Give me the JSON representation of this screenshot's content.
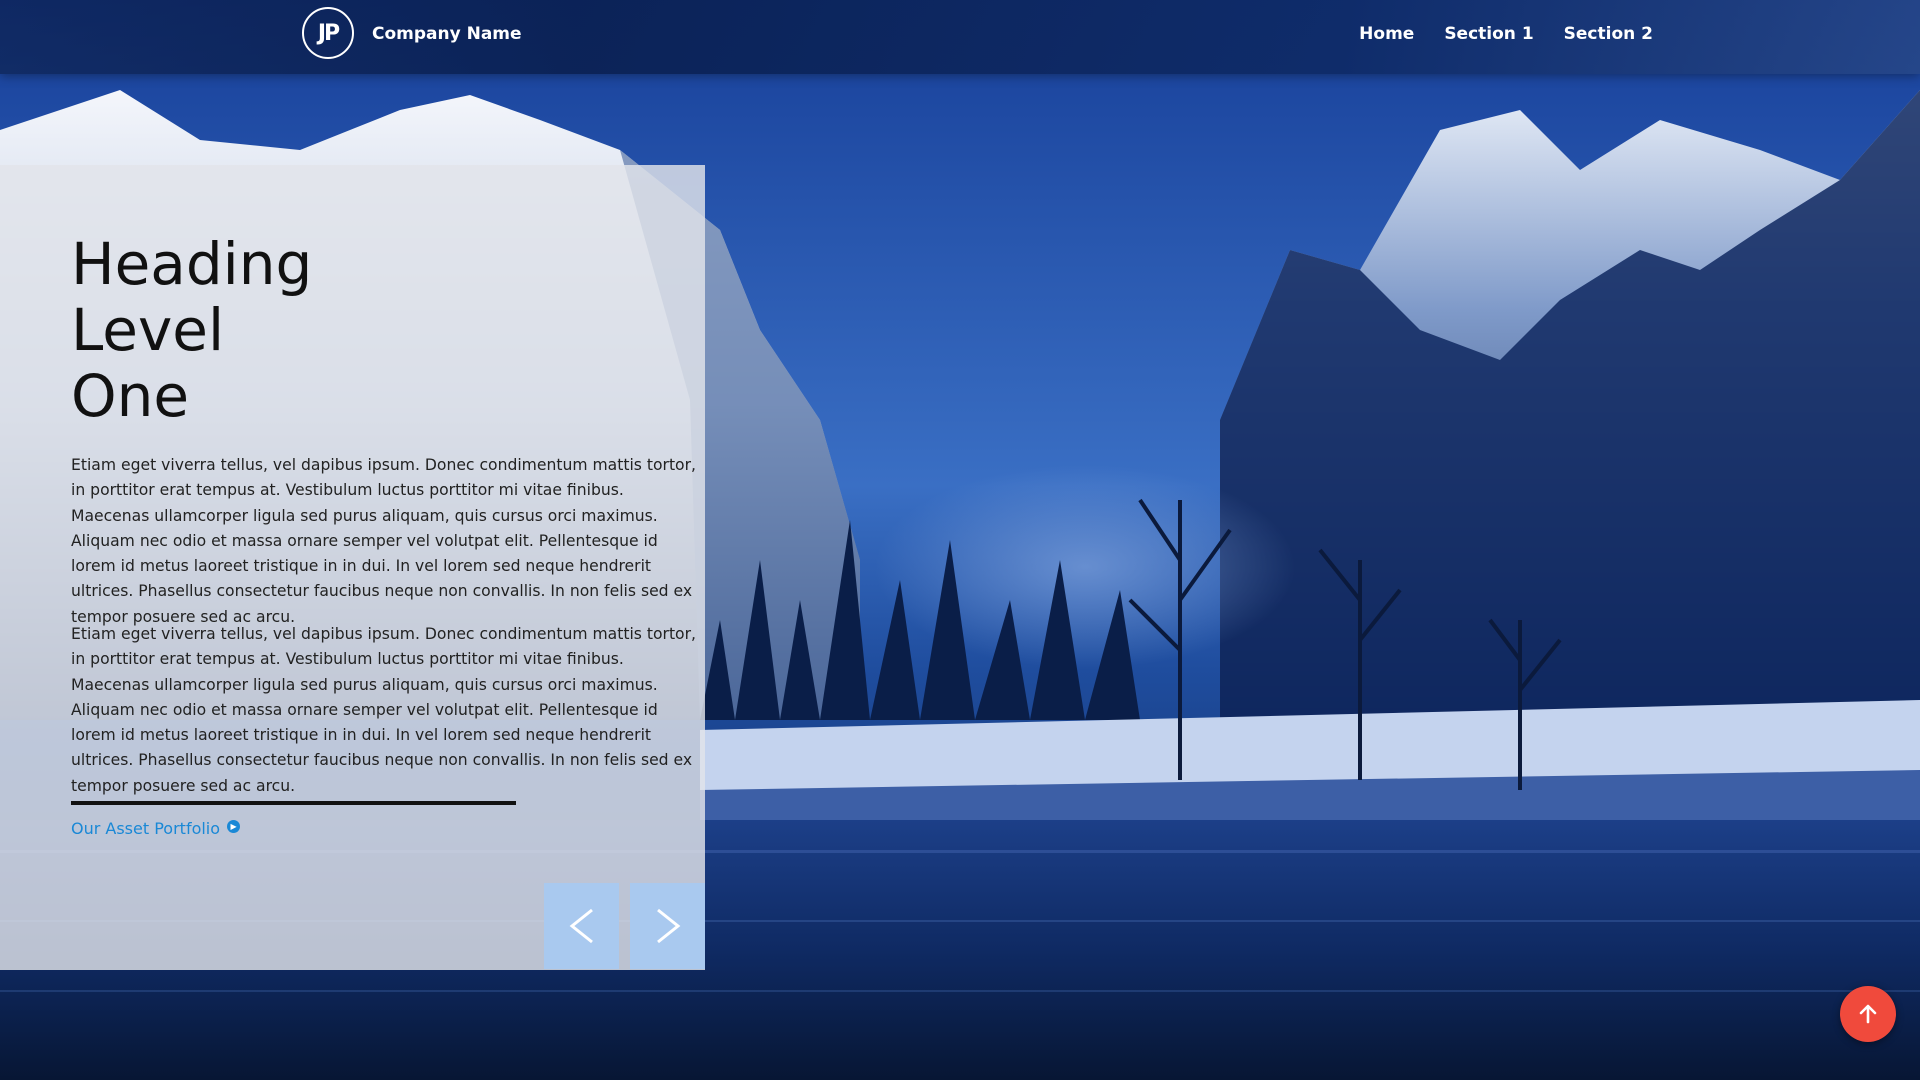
{
  "header": {
    "logo_text": "JP",
    "company_name": "Company Name",
    "nav": [
      {
        "label": "Home"
      },
      {
        "label": "Section 1"
      },
      {
        "label": "Section 2"
      }
    ]
  },
  "hero": {
    "heading_line1": "Heading",
    "heading_line2": "Level",
    "heading_line3": "One",
    "paragraphs": [
      "Etiam eget viverra tellus, vel dapibus ipsum. Donec condimentum mattis tortor, in porttitor erat tempus at. Vestibulum luctus porttitor mi vitae finibus. Maecenas ullamcorper ligula sed purus aliquam, quis cursus orci maximus. Aliquam nec odio et massa ornare semper vel volutpat elit. Pellentesque id lorem id metus laoreet tristique in in dui. In vel lorem sed neque hendrerit ultrices. Phasellus consectetur faucibus neque non convallis. In non felis sed ex tempor posuere sed ac arcu.",
      "Etiam eget viverra tellus, vel dapibus ipsum. Donec condimentum mattis tortor, in porttitor erat tempus at. Vestibulum luctus porttitor mi vitae finibus. Maecenas ullamcorper ligula sed purus aliquam, quis cursus orci maximus. Aliquam nec odio et massa ornare semper vel volutpat elit. Pellentesque id lorem id metus laoreet tristique in in dui. In vel lorem sed neque hendrerit ultrices. Phasellus consectetur faucibus neque non convallis. In non felis sed ex tempor posuere sed ac arcu."
    ],
    "link_label": "Our Asset Portfolio",
    "link_icon": "circle-arrow-right-icon",
    "prev_icon": "chevron-left-icon",
    "next_icon": "chevron-right-icon"
  },
  "scroll_top": {
    "icon": "arrow-up-icon",
    "color": "#f04a3c"
  },
  "colors": {
    "accent_link": "#1a88d6",
    "slider_button": "#a9c9ef",
    "header": "#0e2a66"
  }
}
